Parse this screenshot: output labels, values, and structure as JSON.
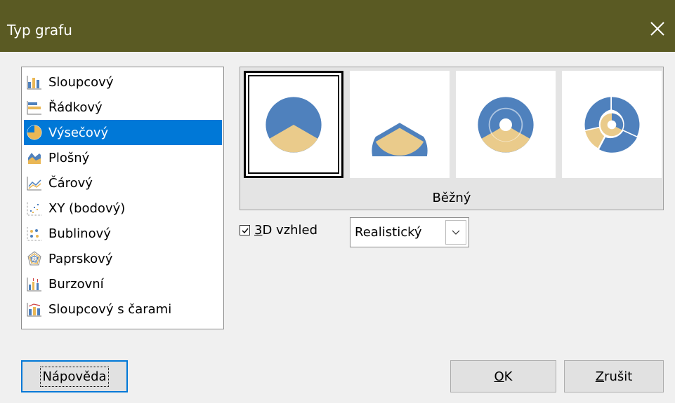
{
  "title": "Typ grafu",
  "chart_types": [
    {
      "label": "Sloupcový",
      "icon": "column-chart-icon"
    },
    {
      "label": "Řádkový",
      "icon": "bar-chart-icon"
    },
    {
      "label": "Výsečový",
      "icon": "pie-chart-icon",
      "selected": true
    },
    {
      "label": "Plošný",
      "icon": "area-chart-icon"
    },
    {
      "label": "Čárový",
      "icon": "line-chart-icon"
    },
    {
      "label": "XY (bodový)",
      "icon": "xy-scatter-icon"
    },
    {
      "label": "Bublinový",
      "icon": "bubble-chart-icon"
    },
    {
      "label": "Paprskový",
      "icon": "radar-chart-icon"
    },
    {
      "label": "Burzovní",
      "icon": "stock-chart-icon"
    },
    {
      "label": "Sloupcový s čarami",
      "icon": "column-line-chart-icon"
    }
  ],
  "variants": {
    "caption": "Běžný",
    "items": [
      {
        "name": "normal-pie-variant",
        "selected": true
      },
      {
        "name": "exploded-pie-variant"
      },
      {
        "name": "donut-variant"
      },
      {
        "name": "exploded-donut-variant"
      }
    ]
  },
  "options": {
    "three_d_checked": true,
    "three_d_label": "3D vzhled",
    "three_d_mnemonic": "3",
    "three_d_rest": "D vzhled",
    "scheme_value": "Realistický"
  },
  "buttons": {
    "help": "Nápověda",
    "ok": "OK",
    "ok_mnemonic": "O",
    "ok_rest": "K",
    "cancel": "Zrušit",
    "cancel_mnemonic": "Z",
    "cancel_rest": "rušit"
  },
  "colors": {
    "titlebar": "#5a5a23",
    "selection": "#0078d7",
    "pie_blue": "#4f81bd",
    "pie_tan": "#eacb8b"
  }
}
